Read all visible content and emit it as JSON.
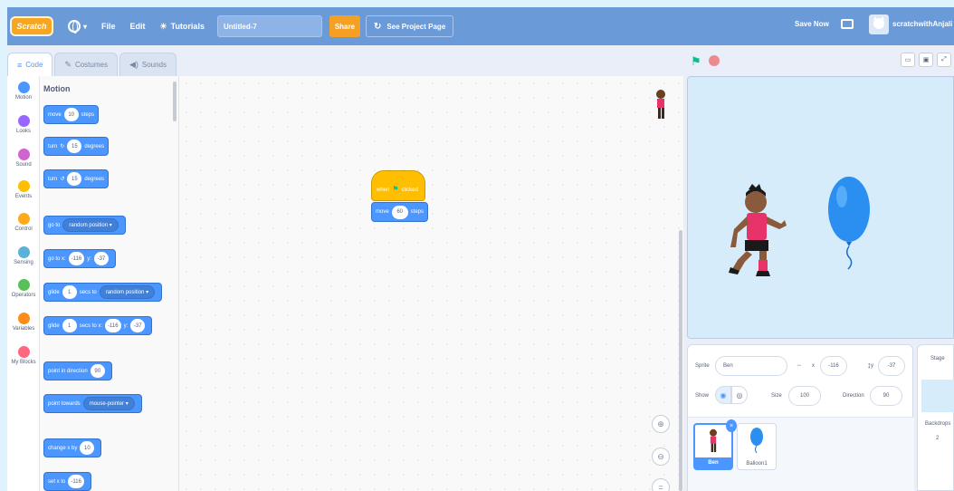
{
  "menubar": {
    "logo": "Scratch",
    "file": "File",
    "edit": "Edit",
    "tutorials": "Tutorials",
    "project_title": "Untitled-7",
    "share": "Share",
    "see_project_page": "See Project Page",
    "save_now": "Save Now",
    "username": "scratchwithAnjali"
  },
  "tabs": [
    {
      "label": "Code",
      "icon": "code-icon"
    },
    {
      "label": "Costumes",
      "icon": "brush-icon"
    },
    {
      "label": "Sounds",
      "icon": "speaker-icon"
    }
  ],
  "categories": [
    {
      "label": "Motion",
      "color": "#4c97ff"
    },
    {
      "label": "Looks",
      "color": "#9966ff"
    },
    {
      "label": "Sound",
      "color": "#cf63cf"
    },
    {
      "label": "Events",
      "color": "#ffbf00"
    },
    {
      "label": "Control",
      "color": "#ffab19"
    },
    {
      "label": "Sensing",
      "color": "#5cb1d6"
    },
    {
      "label": "Operators",
      "color": "#59c059"
    },
    {
      "label": "Variables",
      "color": "#ff8c1a"
    },
    {
      "label": "My Blocks",
      "color": "#ff6680"
    }
  ],
  "palette": {
    "heading": "Motion",
    "move": {
      "a": "move",
      "v": "10",
      "b": "steps"
    },
    "turn_right": {
      "a": "turn",
      "v": "15",
      "b": "degrees"
    },
    "turn_left": {
      "a": "turn",
      "v": "15",
      "b": "degrees"
    },
    "goto_random": {
      "a": "go to",
      "d": "random position"
    },
    "goto_xy": {
      "a": "go to x:",
      "x": "-116",
      "b": "y:",
      "y": "-37"
    },
    "glide_random": {
      "a": "glide",
      "v": "1",
      "b": "secs to",
      "d": "random position"
    },
    "glide_xy": {
      "a": "glide",
      "v": "1",
      "b": "secs to x:",
      "x": "-116",
      "c": "y:",
      "y": "-37"
    },
    "point_dir": {
      "a": "point in direction",
      "v": "90"
    },
    "point_towards": {
      "a": "point towards",
      "d": "mouse-pointer"
    },
    "change_x": {
      "a": "change x by",
      "v": "10"
    },
    "set_x": {
      "a": "set x to",
      "v": "-116"
    }
  },
  "script": {
    "hat": {
      "a": "when",
      "b": "clicked"
    },
    "move": {
      "a": "move",
      "v": "60",
      "b": "steps"
    }
  },
  "sprite_info": {
    "sprite_label": "Sprite",
    "sprite_name": "Ben",
    "x_label": "x",
    "x": "-116",
    "y_label": "y",
    "y": "-37",
    "show_label": "Show",
    "size_label": "Size",
    "size": "100",
    "direction_label": "Direction",
    "direction": "90"
  },
  "sprites": [
    {
      "name": "Ben"
    },
    {
      "name": "Balloon1"
    }
  ],
  "stage_panel": {
    "title": "Stage",
    "backdrops_label": "Backdrops",
    "backdrops_count": "2"
  }
}
